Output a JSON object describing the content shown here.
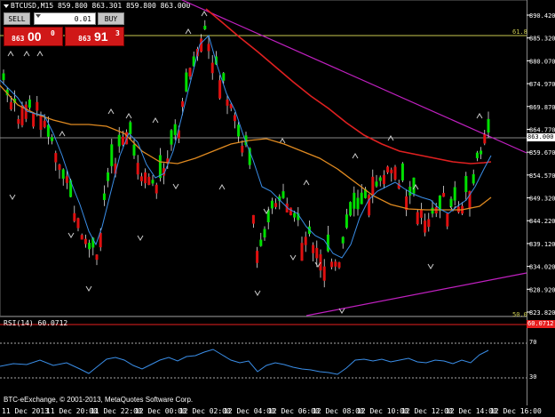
{
  "header": {
    "title": "BTCUSD,M15  859.800 863.301 859.800 863.000"
  },
  "trade_panel": {
    "sell_label": "SELL",
    "buy_label": "BUY",
    "lot_value": "0.01",
    "sell_price": {
      "small": "863",
      "big": "00",
      "sup": "0"
    },
    "buy_price": {
      "small": "863",
      "big": "91",
      "sup": "3"
    }
  },
  "price_axis": {
    "ticks": [
      "890.420",
      "885.320",
      "880.070",
      "874.970",
      "869.870",
      "864.770",
      "859.670",
      "854.570",
      "849.320",
      "844.220",
      "839.120",
      "834.020",
      "828.920",
      "823.820"
    ],
    "current_price": "863.000"
  },
  "fib_levels": [
    {
      "label": "61.8"
    },
    {
      "label": "50.0"
    }
  ],
  "rsi": {
    "title": "RSI(14) 60.0712",
    "value_tag": "60.0712",
    "levels": [
      "70",
      "30"
    ]
  },
  "copyright": "BTC-eExchange, © 2001-2013, MetaQuotes Software Corp.",
  "time_axis": [
    "11 Dec 2013",
    "11 Dec 20:00",
    "11 Dec 22:00",
    "12 Dec 00:00",
    "12 Dec 02:00",
    "12 Dec 04:00",
    "12 Dec 06:00",
    "12 Dec 08:00",
    "12 Dec 10:00",
    "12 Dec 12:00",
    "12 Dec 14:00",
    "12 Dec 16:00"
  ],
  "colors": {
    "bull": "#00e000",
    "bear": "#e01010",
    "ma_fast": "#3a8ee8",
    "ma_mid": "#e02020",
    "ma_slow": "#e08a20",
    "trendline": "#c020c0",
    "fib": "#c8c850"
  }
}
